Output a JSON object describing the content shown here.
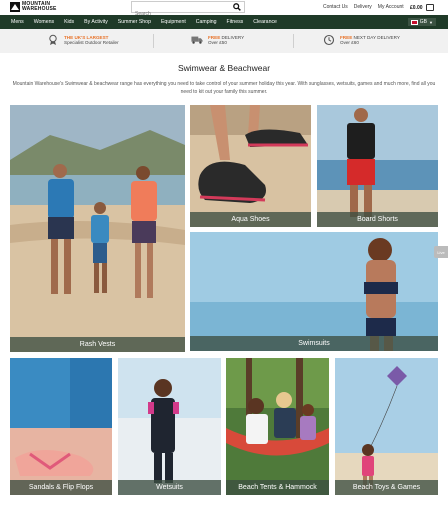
{
  "header": {
    "logo_line1": "MOUNTAIN",
    "logo_line2": "WAREHOUSE",
    "search_placeholder": "Search",
    "links": [
      "Contact Us",
      "Delivery",
      "My Account"
    ],
    "basket_total": "£0.00"
  },
  "nav": {
    "items": [
      "Mens",
      "Womens",
      "Kids",
      "By Activity",
      "Summer Shop",
      "Equipment",
      "Camping",
      "Fitness",
      "Clearance"
    ],
    "region": "GB"
  },
  "usp": [
    {
      "highlight": "THE UK'S LARGEST",
      "text": "Specialist Outdoor Retailer",
      "icon": "award-icon"
    },
    {
      "highlight": "FREE",
      "highlight_rest": " DELIVERY",
      "text": "Over £50",
      "icon": "truck-icon"
    },
    {
      "highlight": "FREE",
      "highlight_rest": " NEXT DAY DELIVERY",
      "text": "Over £60",
      "icon": "clock-icon"
    }
  ],
  "page": {
    "title": "Swimwear & Beachwear",
    "description": "Mountain Warehouse's Swimwear & beachwear range has everything you need to take control of your summer holiday this year. With sunglasses, wetsuits, games and much more, find all you need to kit out your family this summer."
  },
  "tiles": [
    {
      "label": "Rash Vests"
    },
    {
      "label": "Aqua Shoes"
    },
    {
      "label": "Board Shorts"
    },
    {
      "label": "Swimsuits"
    },
    {
      "label": "Sandals & Flip Flops"
    },
    {
      "label": "Wetsuits"
    },
    {
      "label": "Beach Tents & Hammock"
    },
    {
      "label": "Beach Toys & Games"
    }
  ],
  "side_tab": "Live",
  "colors": {
    "nav_bg": "#1f3a28",
    "accent": "#e8732a",
    "label_bg": "#3c4e41"
  }
}
